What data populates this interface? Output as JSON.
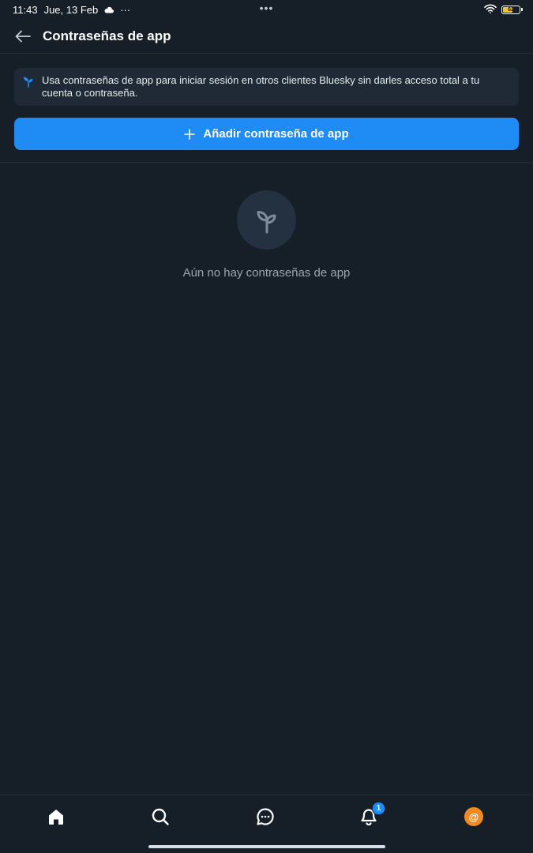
{
  "status_bar": {
    "time": "11:43",
    "date": "Jue, 13 Feb",
    "center_dots": "•••",
    "more_dots": "···",
    "battery_level": "62",
    "battery_fraction": 0.62,
    "icons": [
      "cloud-icon",
      "wifi-icon",
      "battery-icon"
    ]
  },
  "header": {
    "title": "Contraseñas de app",
    "back_icon": "arrow-left-icon"
  },
  "info": {
    "icon": "sprout-icon",
    "text": "Usa contraseñas de app para iniciar sesión en otros clientes Bluesky sin darles acceso total a tu cuenta o contraseña."
  },
  "add_button": {
    "icon": "plus-icon",
    "label": "Añadir contraseña de app"
  },
  "empty_state": {
    "icon": "sprout-icon",
    "text": "Aún no hay contraseñas de app"
  },
  "bottom_nav": {
    "items": [
      {
        "name": "home",
        "icon": "home-icon"
      },
      {
        "name": "search",
        "icon": "search-icon"
      },
      {
        "name": "chat",
        "icon": "chat-icon"
      },
      {
        "name": "notifications",
        "icon": "bell-icon",
        "badge": "1"
      },
      {
        "name": "profile",
        "icon": "avatar-icon",
        "avatar_glyph": "@"
      }
    ]
  },
  "colors": {
    "background": "#161e27",
    "accent": "#1f8bf5",
    "info_bg": "#1f2a36",
    "muted_text": "#9aa5b2",
    "avatar": "#f5891f"
  }
}
